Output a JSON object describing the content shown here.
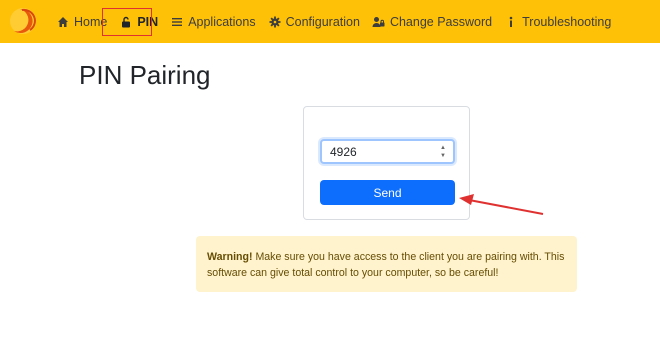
{
  "navbar": {
    "items": [
      {
        "id": "home",
        "label": "Home",
        "icon": "home-icon"
      },
      {
        "id": "pin",
        "label": "PIN",
        "icon": "lock-open-icon",
        "active": true
      },
      {
        "id": "applications",
        "label": "Applications",
        "icon": "list-icon"
      },
      {
        "id": "configuration",
        "label": "Configuration",
        "icon": "gear-icon"
      },
      {
        "id": "change_password",
        "label": "Change Password",
        "icon": "user-lock-icon"
      },
      {
        "id": "troubleshooting",
        "label": "Troubleshooting",
        "icon": "info-icon"
      }
    ],
    "background": "#ffc107",
    "highlight_color": "#e03131"
  },
  "page": {
    "title": "PIN Pairing"
  },
  "pin_form": {
    "pin_value": "4926",
    "send_label": "Send",
    "button_color": "#0d6efd"
  },
  "alert": {
    "strong": "Warning!",
    "text": " Make sure you have access to the client you are pairing with. This software can give total control to your computer, so be careful!",
    "background": "#fff3cd"
  }
}
